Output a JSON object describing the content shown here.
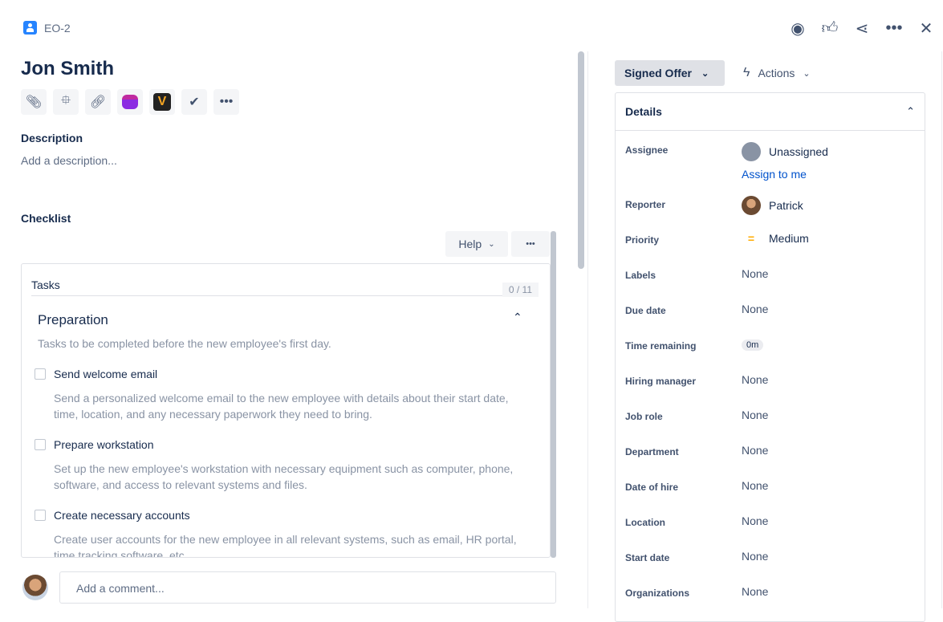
{
  "issue_key": "EO-2",
  "title": "Jon Smith",
  "top_actions": [
    "watch-icon",
    "like-icon",
    "share-icon",
    "more-icon",
    "close-icon"
  ],
  "toolbar_icons": [
    "attachment-icon",
    "child-issues-icon",
    "link-icon",
    "app-purple-icon",
    "app-v-icon",
    "checklist-icon",
    "more-icon"
  ],
  "description": {
    "title": "Description",
    "placeholder": "Add a description..."
  },
  "checklist": {
    "title": "Checklist",
    "help_label": "Help",
    "more": "•••",
    "tasks_label": "Tasks",
    "progress": "0 / 11",
    "group": {
      "title": "Preparation",
      "description": "Tasks to be completed before the new employee's first day."
    },
    "items": [
      {
        "label": "Send welcome email",
        "desc": "Send a personalized welcome email to the new employee with details about their start date, time, location, and any necessary paperwork they need to bring.",
        "checked": false
      },
      {
        "label": "Prepare workstation",
        "desc": "Set up the new employee's workstation with necessary equipment such as computer, phone, software, and access to relevant systems and files.",
        "checked": false
      },
      {
        "label": "Create necessary accounts",
        "desc": "Create user accounts for the new employee in all relevant systems, such as email, HR portal, time tracking software, etc.",
        "checked": false
      }
    ]
  },
  "comment": {
    "placeholder": "Add a comment..."
  },
  "status": {
    "label": "Signed Offer"
  },
  "actions": {
    "label": "Actions"
  },
  "details": {
    "title": "Details",
    "assignee": {
      "label": "Assignee",
      "value": "Unassigned",
      "assign_link": "Assign to me"
    },
    "reporter": {
      "label": "Reporter",
      "value": "Patrick"
    },
    "priority": {
      "label": "Priority",
      "value": "Medium",
      "color": "#ffab00"
    },
    "fields": [
      {
        "label": "Labels",
        "value": "None"
      },
      {
        "label": "Due date",
        "value": "None"
      },
      {
        "label": "Time remaining",
        "value": "0m"
      },
      {
        "label": "Hiring manager",
        "value": "None"
      },
      {
        "label": "Job role",
        "value": "None"
      },
      {
        "label": "Department",
        "value": "None"
      },
      {
        "label": "Date of hire",
        "value": "None"
      },
      {
        "label": "Location",
        "value": "None"
      },
      {
        "label": "Start date",
        "value": "None"
      },
      {
        "label": "Organizations",
        "value": "None"
      }
    ]
  }
}
